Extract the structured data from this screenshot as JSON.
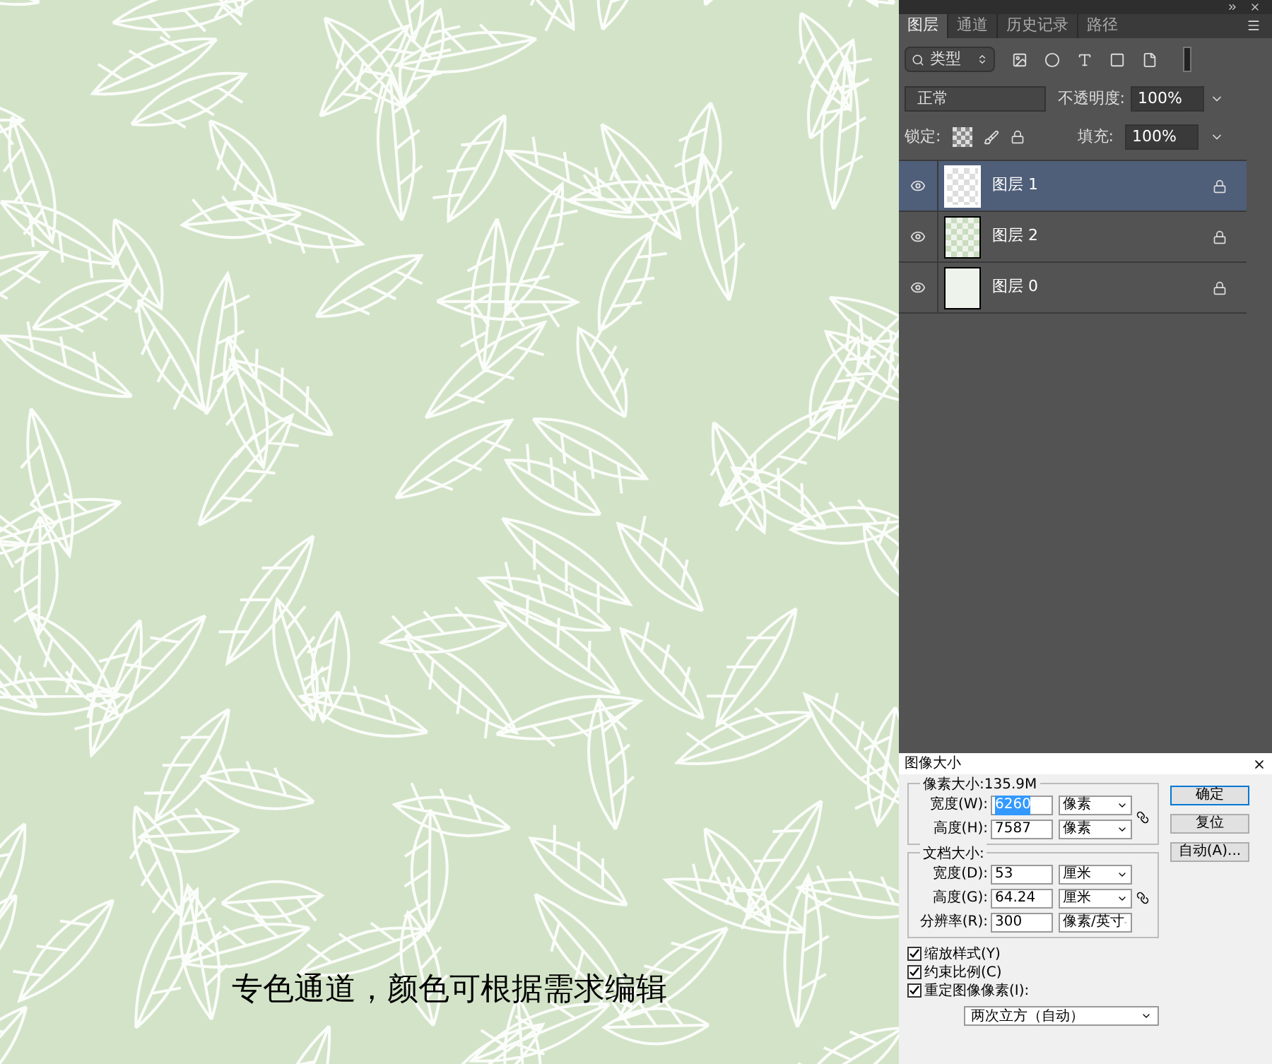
{
  "image": {
    "caption": "专色通道，颜色可根据需求编辑"
  },
  "layers_panel": {
    "tabs": [
      {
        "label": "图层",
        "selected": true
      },
      {
        "label": "通道",
        "selected": false
      },
      {
        "label": "历史记录",
        "selected": false
      },
      {
        "label": "路径",
        "selected": false
      }
    ],
    "filter": {
      "value": "类型"
    },
    "blend_mode": "正常",
    "opacity": {
      "label": "不透明度:",
      "value": "100%"
    },
    "lock_label": "锁定:",
    "fill": {
      "label": "填充:",
      "value": "100%"
    },
    "layers": [
      {
        "name": "图层 1",
        "selected": true,
        "visible": true,
        "kind": "transparent"
      },
      {
        "name": "图层 2",
        "selected": false,
        "visible": true,
        "kind": "pattern"
      },
      {
        "name": "图层 0",
        "selected": false,
        "visible": true,
        "kind": "solid"
      }
    ]
  },
  "dialog": {
    "title": "图像大小",
    "pixel_group": {
      "title": "像素大小:135.9M",
      "rows": [
        {
          "label": "宽度(W):",
          "value": "6260",
          "selected": true,
          "unit": "像素"
        },
        {
          "label": "高度(H):",
          "value": "7587",
          "selected": false,
          "unit": "像素"
        }
      ]
    },
    "document_group": {
      "title": "文档大小:",
      "rows": [
        {
          "label": "宽度(D):",
          "value": "53",
          "selected": false,
          "unit": "厘米"
        },
        {
          "label": "高度(G):",
          "value": "64.24",
          "selected": false,
          "unit": "厘米"
        },
        {
          "label": "分辨率(R):",
          "value": "300",
          "selected": false,
          "unit": "像素/英寸"
        }
      ]
    },
    "buttons": [
      {
        "label": "确定",
        "selected": true
      },
      {
        "label": "复位",
        "selected": false
      },
      {
        "label": "自动(A)...",
        "selected": false
      }
    ],
    "checkboxes": [
      {
        "label": "缩放样式(Y)",
        "checked": true
      },
      {
        "label": "约束比例(C)",
        "checked": true
      },
      {
        "label": "重定图像像素(I):",
        "checked": true
      }
    ],
    "resample": "两次立方（自动）"
  }
}
